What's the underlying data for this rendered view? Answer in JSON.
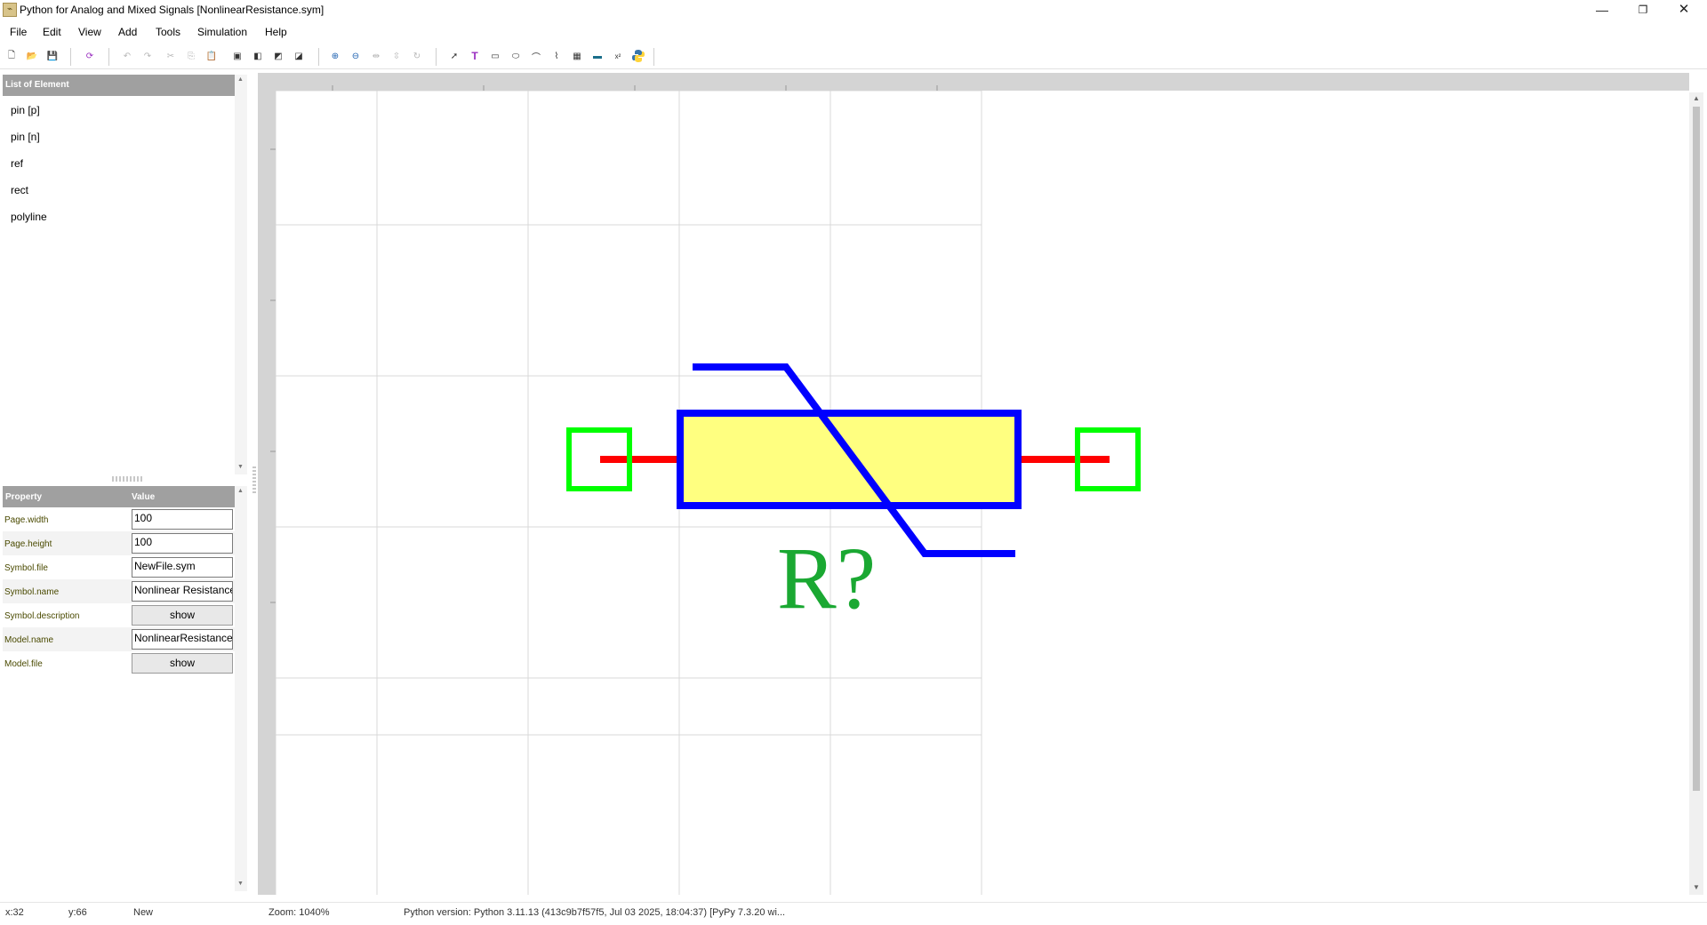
{
  "window": {
    "title": "Python for Analog and Mixed Signals [NonlinearResistance.sym]",
    "app_icon": "app-icon",
    "controls": [
      "minimize-icon",
      "restore-icon",
      "close-icon"
    ]
  },
  "menu": [
    "File",
    "Edit",
    "View",
    "Add",
    "Tools",
    "Simulation",
    "Help"
  ],
  "toolbar": {
    "icons": [
      "new-file-icon",
      "open-folder-icon",
      "save-icon",
      "refresh-symbol-icon",
      "undo-icon",
      "redo-icon",
      "cut-icon",
      "copy-icon",
      "paste-icon",
      "bring-front-icon",
      "send-back-icon",
      "move-up-icon",
      "move-down-icon",
      "zoom-in-icon",
      "zoom-out-icon",
      "flip-horizontal-icon",
      "flip-vertical-icon",
      "rotate-icon",
      "select-pointer-icon",
      "text-icon",
      "rectangle-icon",
      "ellipse-icon",
      "arc-icon",
      "polyline-icon",
      "image-icon",
      "pin-icon",
      "equation-icon",
      "python-icon"
    ],
    "colors": {
      "accent_purple": "#9a2fc0",
      "python_blue": "#3776ab",
      "python_yellow": "#ffd43b"
    }
  },
  "elements_panel": {
    "header": "List of Element",
    "items": [
      "pin [p]",
      "pin [n]",
      "ref",
      "rect",
      "polyline"
    ]
  },
  "properties_panel": {
    "header_property": "Property",
    "header_value": "Value",
    "rows": [
      {
        "name": "Page.width",
        "kind": "input",
        "value": "100"
      },
      {
        "name": "Page.height",
        "kind": "input",
        "value": "100"
      },
      {
        "name": "Symbol.file",
        "kind": "input",
        "value": "NewFile.sym"
      },
      {
        "name": "Symbol.name",
        "kind": "input",
        "value": "Nonlinear Resistance"
      },
      {
        "name": "Symbol.description",
        "kind": "button",
        "value": "show"
      },
      {
        "name": "Model.name",
        "kind": "input",
        "value": "NonlinearResistance"
      },
      {
        "name": "Model.file",
        "kind": "button",
        "value": "show"
      }
    ]
  },
  "canvas": {
    "ref_label": "R?",
    "colors": {
      "pin_box": "#00ff00",
      "pin_line": "#ff0000",
      "body_fill": "#ffff80",
      "body_stroke": "#0000ff",
      "ref_text": "#1aa832",
      "grid": "#d8d8d8",
      "ruler": "#d4d4d4"
    }
  },
  "status": {
    "x": "x:32",
    "y": "y:66",
    "mode": "New",
    "zoom": "Zoom: 1040%",
    "python": "Python version: Python 3.11.13 (413c9b7f57f5, Jul 03 2025, 18:04:37) [PyPy 7.3.20 wi..."
  }
}
